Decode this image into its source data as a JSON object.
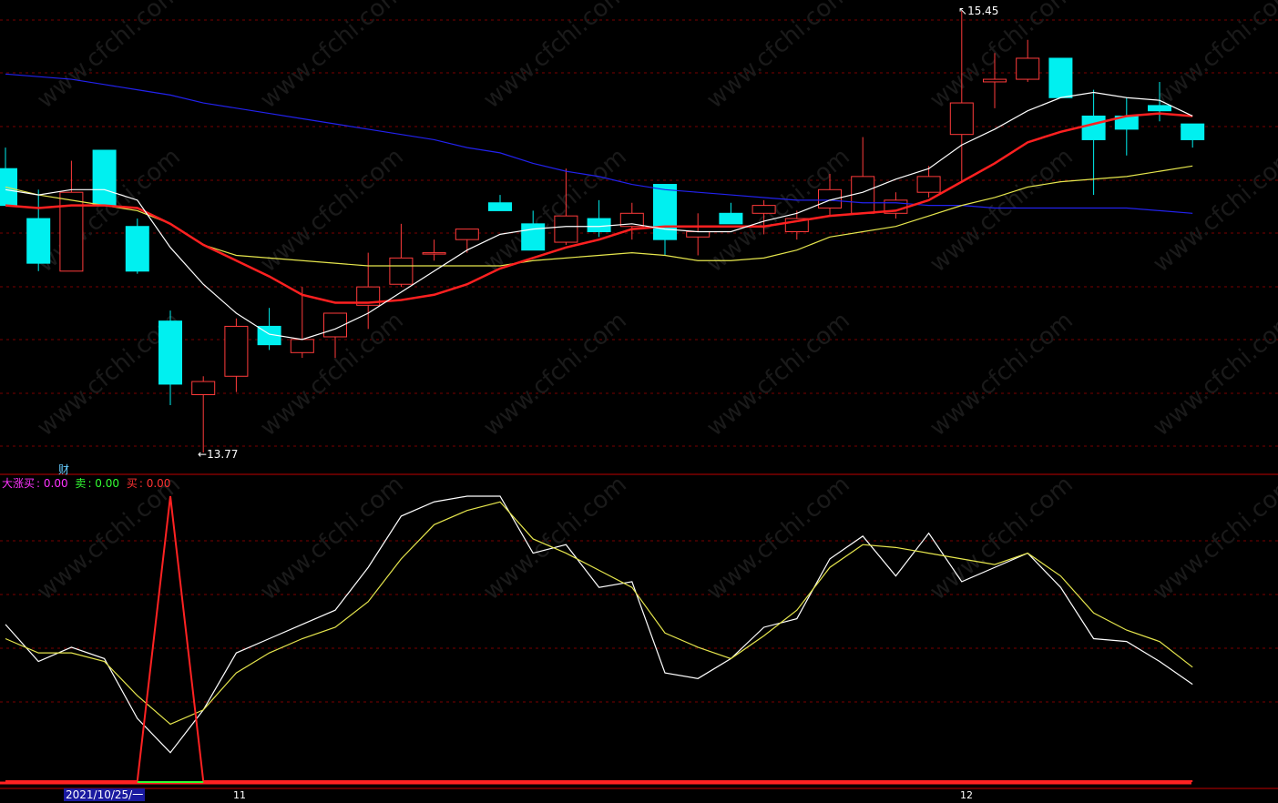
{
  "chart_data": [
    {
      "type": "candlestick",
      "title": "",
      "annotations": {
        "high": "15.45",
        "low": "13.77"
      },
      "candles": [
        {
          "o": 14.85,
          "h": 14.93,
          "c": 14.71,
          "l": 14.71
        },
        {
          "o": 14.66,
          "h": 14.77,
          "c": 14.49,
          "l": 14.46
        },
        {
          "o": 14.46,
          "h": 14.88,
          "c": 14.76,
          "l": 14.46
        },
        {
          "o": 14.92,
          "h": 14.92,
          "c": 14.71,
          "l": 14.71
        },
        {
          "o": 14.63,
          "h": 14.66,
          "c": 14.46,
          "l": 14.45
        },
        {
          "o": 14.27,
          "h": 14.31,
          "c": 14.03,
          "l": 13.95
        },
        {
          "o": 13.99,
          "h": 14.06,
          "c": 14.04,
          "l": 13.77
        },
        {
          "o": 14.06,
          "h": 14.28,
          "c": 14.25,
          "l": 14.0
        },
        {
          "o": 14.25,
          "h": 14.32,
          "c": 14.18,
          "l": 14.16
        },
        {
          "o": 14.15,
          "h": 14.4,
          "c": 14.2,
          "l": 14.13
        },
        {
          "o": 14.21,
          "h": 14.3,
          "c": 14.3,
          "l": 14.13
        },
        {
          "o": 14.33,
          "h": 14.53,
          "c": 14.4,
          "l": 14.24
        },
        {
          "o": 14.41,
          "h": 14.64,
          "c": 14.51,
          "l": 14.4
        },
        {
          "o": 14.53,
          "h": 14.58,
          "c": 14.53,
          "l": 14.5
        },
        {
          "o": 14.58,
          "h": 14.59,
          "c": 14.62,
          "l": 14.53
        },
        {
          "o": 14.72,
          "h": 14.75,
          "c": 14.69,
          "l": 14.69
        },
        {
          "o": 14.64,
          "h": 14.69,
          "c": 14.54,
          "l": 14.54
        },
        {
          "o": 14.57,
          "h": 14.85,
          "c": 14.67,
          "l": 14.56
        },
        {
          "o": 14.66,
          "h": 14.73,
          "c": 14.61,
          "l": 14.59
        },
        {
          "o": 14.63,
          "h": 14.72,
          "c": 14.68,
          "l": 14.58
        },
        {
          "o": 14.79,
          "h": 14.79,
          "c": 14.58,
          "l": 14.52
        },
        {
          "o": 14.59,
          "h": 14.68,
          "c": 14.61,
          "l": 14.52
        },
        {
          "o": 14.68,
          "h": 14.72,
          "c": 14.64,
          "l": 14.64
        },
        {
          "o": 14.68,
          "h": 14.73,
          "c": 14.71,
          "l": 14.6
        },
        {
          "o": 14.61,
          "h": 14.69,
          "c": 14.66,
          "l": 14.58
        },
        {
          "o": 14.7,
          "h": 14.83,
          "c": 14.77,
          "l": 14.67
        },
        {
          "o": 14.68,
          "h": 14.97,
          "c": 14.82,
          "l": 14.68
        },
        {
          "o": 14.68,
          "h": 14.76,
          "c": 14.73,
          "l": 14.66
        },
        {
          "o": 14.76,
          "h": 14.86,
          "c": 14.82,
          "l": 14.74
        },
        {
          "o": 14.98,
          "h": 15.45,
          "c": 15.1,
          "l": 14.8
        },
        {
          "o": 15.18,
          "h": 15.29,
          "c": 15.19,
          "l": 15.08
        },
        {
          "o": 15.19,
          "h": 15.34,
          "c": 15.27,
          "l": 15.18
        },
        {
          "o": 15.27,
          "h": 15.19,
          "c": 15.12,
          "l": 15.12
        },
        {
          "o": 15.05,
          "h": 15.15,
          "c": 14.96,
          "l": 14.75
        },
        {
          "o": 15.05,
          "h": 15.12,
          "c": 15.0,
          "l": 14.9
        },
        {
          "o": 15.09,
          "h": 15.18,
          "c": 15.07,
          "l": 15.03
        },
        {
          "o": 15.02,
          "h": 15.02,
          "c": 14.96,
          "l": 14.93
        }
      ],
      "ma_white": [
        14.77,
        14.75,
        14.77,
        14.77,
        14.73,
        14.55,
        14.41,
        14.3,
        14.22,
        14.2,
        14.24,
        14.3,
        14.38,
        14.46,
        14.54,
        14.6,
        14.62,
        14.63,
        14.63,
        14.64,
        14.62,
        14.61,
        14.61,
        14.65,
        14.68,
        14.73,
        14.76,
        14.81,
        14.85,
        14.94,
        15.0,
        15.07,
        15.12,
        15.14,
        15.12,
        15.11,
        15.05
      ],
      "ma_red": [
        14.71,
        14.7,
        14.71,
        14.71,
        14.7,
        14.64,
        14.56,
        14.5,
        14.44,
        14.37,
        14.34,
        14.34,
        14.35,
        14.37,
        14.41,
        14.47,
        14.51,
        14.55,
        14.58,
        14.62,
        14.63,
        14.63,
        14.63,
        14.63,
        14.65,
        14.67,
        14.68,
        14.69,
        14.73,
        14.8,
        14.87,
        14.95,
        14.99,
        15.02,
        15.05,
        15.06,
        15.05
      ],
      "ma_yellow": [
        14.78,
        14.75,
        14.73,
        14.71,
        14.69,
        14.64,
        14.56,
        14.52,
        14.51,
        14.5,
        14.49,
        14.48,
        14.48,
        14.48,
        14.48,
        14.48,
        14.5,
        14.51,
        14.52,
        14.53,
        14.52,
        14.5,
        14.5,
        14.51,
        14.54,
        14.59,
        14.61,
        14.63,
        14.67,
        14.71,
        14.74,
        14.78,
        14.8,
        14.81,
        14.82,
        14.84,
        14.86
      ],
      "ma_blue": [
        15.21,
        15.2,
        15.19,
        15.17,
        15.15,
        15.13,
        15.1,
        15.08,
        15.06,
        15.04,
        15.02,
        15.0,
        14.98,
        14.96,
        14.93,
        14.91,
        14.87,
        14.84,
        14.82,
        14.79,
        14.77,
        14.76,
        14.75,
        14.74,
        14.73,
        14.73,
        14.72,
        14.72,
        14.71,
        14.71,
        14.7,
        14.7,
        14.7,
        14.7,
        14.7,
        14.69,
        14.68
      ]
    },
    {
      "type": "line",
      "title": "",
      "legend": [
        {
          "name": "大涨买",
          "value": "0.00",
          "color": "#ff33ff"
        },
        {
          "name": "卖",
          "value": "0.00",
          "color": "#33ff33"
        },
        {
          "name": "买",
          "value": "0.00",
          "color": "#ff3333"
        }
      ],
      "ylim": [
        0,
        100
      ],
      "series": [
        {
          "name": "K",
          "color": "#ffffff",
          "values": [
            55,
            42,
            47,
            43,
            22,
            10,
            25,
            45,
            50,
            55,
            60,
            75,
            93,
            98,
            100,
            100,
            80,
            83,
            68,
            70,
            38,
            36,
            43,
            54,
            57,
            78,
            86,
            72,
            87,
            70,
            75,
            80,
            68,
            50,
            49,
            42,
            34
          ]
        },
        {
          "name": "D",
          "color": "#e6e64d",
          "values": [
            50,
            45,
            45,
            42,
            30,
            20,
            25,
            38,
            45,
            50,
            54,
            63,
            78,
            90,
            95,
            98,
            85,
            80,
            74,
            68,
            52,
            47,
            43,
            51,
            60,
            75,
            83,
            82,
            80,
            78,
            76,
            80,
            72,
            59,
            53,
            49,
            40
          ]
        },
        {
          "name": "buy",
          "color": "#ff2222",
          "values": [
            0,
            0,
            0,
            0,
            0,
            100,
            0,
            0,
            0,
            0,
            0,
            0,
            0,
            0,
            0,
            0,
            0,
            0,
            0,
            0,
            0,
            0,
            0,
            0,
            0,
            0,
            0,
            0,
            0,
            0,
            0,
            0,
            0,
            0,
            0,
            0,
            0
          ]
        }
      ]
    }
  ],
  "top_label": "财",
  "x_axis": {
    "date_box": "2021/10/25/一",
    "tick_11": "11",
    "tick_12": "12"
  },
  "watermark": "www.cfchi.com",
  "colors": {
    "up": "#ff3b3b",
    "down": "#00f0f0",
    "ma_white": "#ffffff",
    "ma_red": "#ff2020",
    "ma_yellow": "#e6e64d",
    "ma_blue": "#2222ee",
    "grid": "#7a0000",
    "divider": "#c00000"
  }
}
